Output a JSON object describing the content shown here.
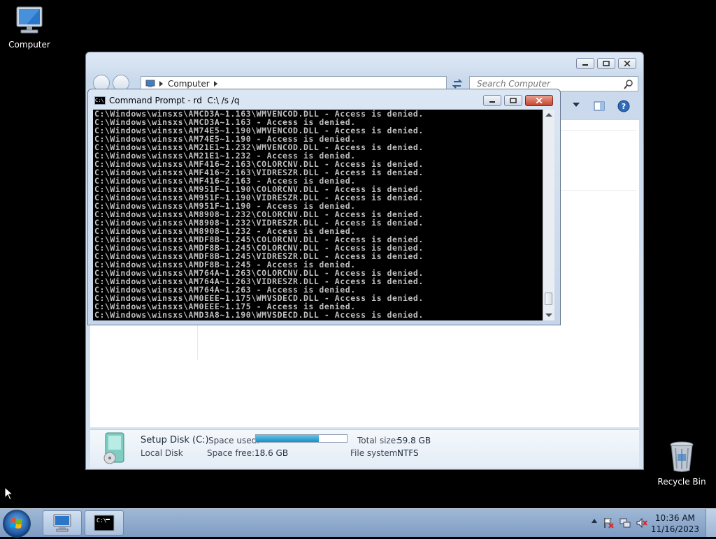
{
  "desktop": {
    "icons": [
      {
        "label": "Computer",
        "icon": "computer-icon"
      },
      {
        "label": "Recycle Bin",
        "icon": "recycle-bin-icon"
      }
    ]
  },
  "explorer": {
    "address": {
      "crumb": "Computer"
    },
    "search": {
      "placeholder": "Search Computer"
    },
    "details": {
      "drive_name": "Setup Disk (C:)",
      "drive_type": "Local Disk",
      "space_used_label": "Space used:",
      "space_used_fraction": 0.69,
      "space_free_label": "Space free:",
      "space_free_value": "18.6 GB",
      "total_size_label": "Total size:",
      "total_size_value": "59.8 GB",
      "file_system_label": "File system:",
      "file_system_value": "NTFS"
    }
  },
  "cmd": {
    "title": "Command Prompt - rd  C:\\ /s /q",
    "icon_text": "C:\\",
    "lines": [
      "C:\\Windows\\winsxs\\AMCD3A~1.163\\WMVENCOD.DLL - Access is denied.",
      "C:\\Windows\\winsxs\\AMCD3A~1.163 - Access is denied.",
      "C:\\Windows\\winsxs\\AM74E5~1.190\\WMVENCOD.DLL - Access is denied.",
      "C:\\Windows\\winsxs\\AM74E5~1.190 - Access is denied.",
      "C:\\Windows\\winsxs\\AM21E1~1.232\\WMVENCOD.DLL - Access is denied.",
      "C:\\Windows\\winsxs\\AM21E1~1.232 - Access is denied.",
      "C:\\Windows\\winsxs\\AMF416~2.163\\COLORCNV.DLL - Access is denied.",
      "C:\\Windows\\winsxs\\AMF416~2.163\\VIDRESZR.DLL - Access is denied.",
      "C:\\Windows\\winsxs\\AMF416~2.163 - Access is denied.",
      "C:\\Windows\\winsxs\\AM951F~1.190\\COLORCNV.DLL - Access is denied.",
      "C:\\Windows\\winsxs\\AM951F~1.190\\VIDRESZR.DLL - Access is denied.",
      "C:\\Windows\\winsxs\\AM951F~1.190 - Access is denied.",
      "C:\\Windows\\winsxs\\AM8908~1.232\\COLORCNV.DLL - Access is denied.",
      "C:\\Windows\\winsxs\\AM8908~1.232\\VIDRESZR.DLL - Access is denied.",
      "C:\\Windows\\winsxs\\AM8908~1.232 - Access is denied.",
      "C:\\Windows\\winsxs\\AMDF8B~1.245\\COLORCNV.DLL - Access is denied.",
      "C:\\Windows\\winsxs\\AMDF8B~1.245\\COLORCNV.DLL - Access is denied.",
      "C:\\Windows\\winsxs\\AMDF8B~1.245\\VIDRESZR.DLL - Access is denied.",
      "C:\\Windows\\winsxs\\AMDF8B~1.245 - Access is denied.",
      "C:\\Windows\\winsxs\\AM764A~1.263\\COLORCNV.DLL - Access is denied.",
      "C:\\Windows\\winsxs\\AM764A~1.263\\VIDRESZR.DLL - Access is denied.",
      "C:\\Windows\\winsxs\\AM764A~1.263 - Access is denied.",
      "C:\\Windows\\winsxs\\AM0EEE~1.175\\WMVSDECD.DLL - Access is denied.",
      "C:\\Windows\\winsxs\\AM0EEE~1.175 - Access is denied.",
      "C:\\Windows\\winsxs\\AMD3A8~1.190\\WMVSDECD.DLL - Access is denied."
    ]
  },
  "taskbar": {
    "clock_time": "10:36 AM",
    "clock_date": "11/16/2023",
    "cmd_icon_text": "C:\\",
    "buttons": [
      {
        "icon": "explorer-computer-icon"
      },
      {
        "icon": "command-prompt-icon"
      }
    ]
  }
}
